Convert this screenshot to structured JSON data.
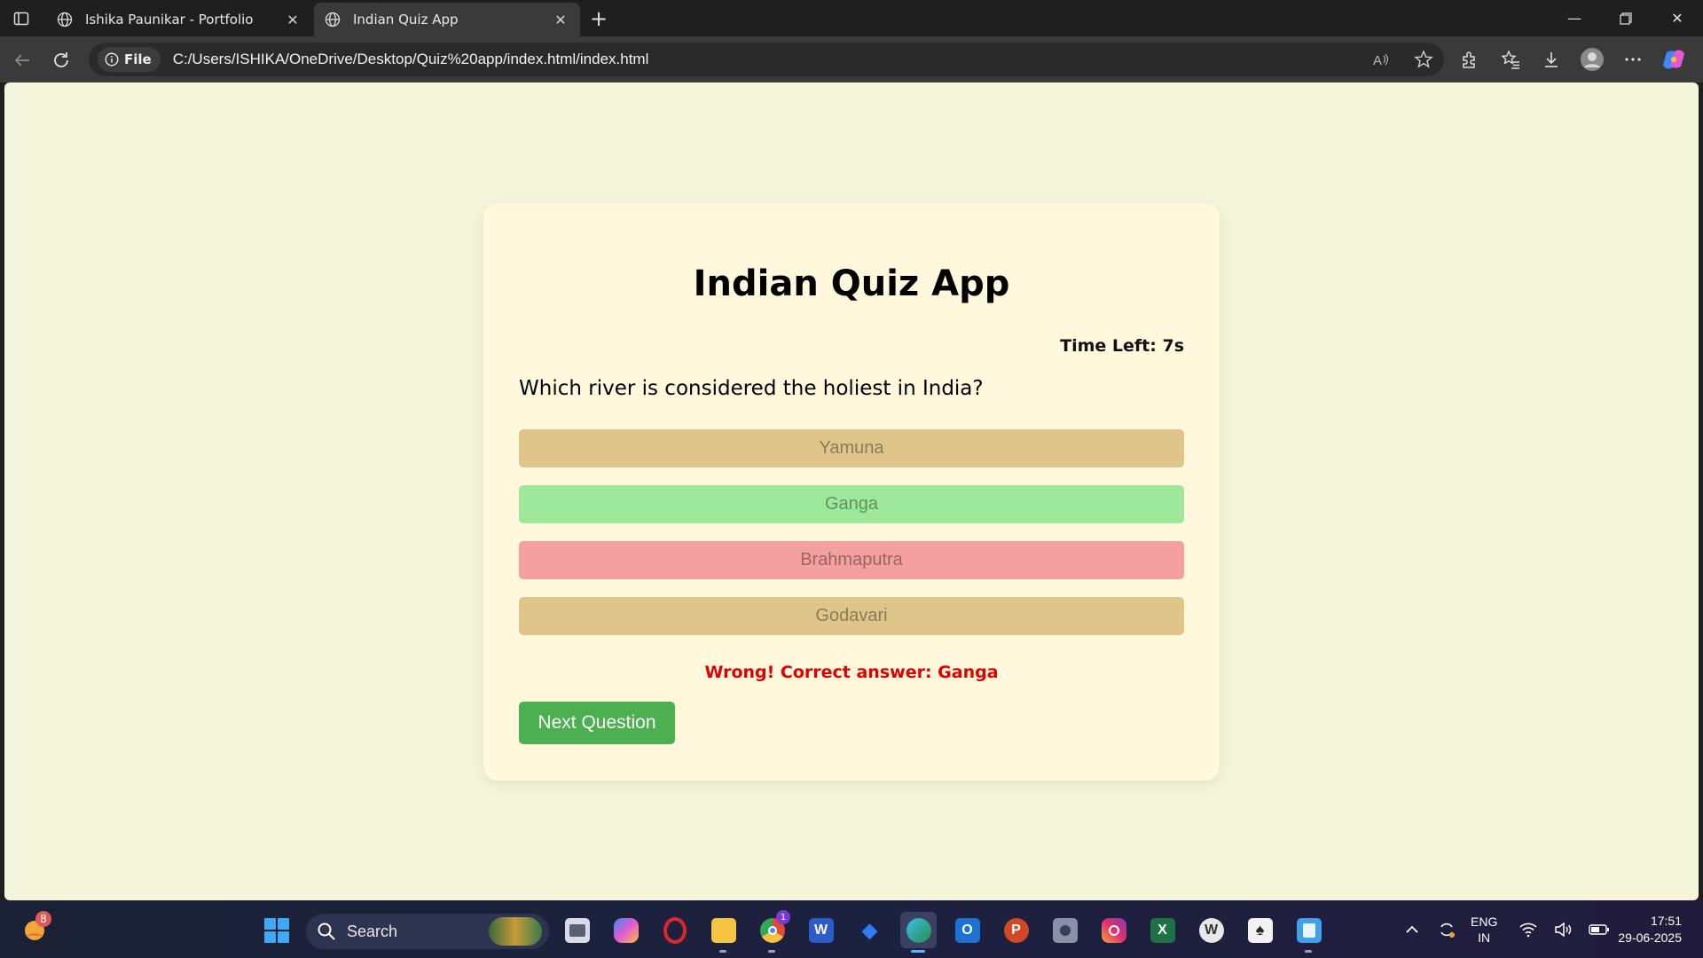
{
  "browser": {
    "tabs": [
      {
        "title": "Ishika Paunikar - Portfolio",
        "active": false
      },
      {
        "title": "Indian Quiz App",
        "active": true
      }
    ],
    "address": {
      "scheme_badge": "File",
      "url": "C:/Users/ISHIKA/OneDrive/Desktop/Quiz%20app/index.html/index.html"
    }
  },
  "quiz": {
    "title": "Indian Quiz App",
    "timer": "Time Left: 7s",
    "question": "Which river is considered the holiest in India?",
    "options": [
      {
        "label": "Yamuna",
        "state": "disabled",
        "color": "#e0c58b"
      },
      {
        "label": "Ganga",
        "state": "correct",
        "color": "#9de89a"
      },
      {
        "label": "Brahmaputra",
        "state": "wrong",
        "color": "#f4a0a0"
      },
      {
        "label": "Godavari",
        "state": "disabled",
        "color": "#e0c58b"
      }
    ],
    "feedback": "Wrong! Correct answer: Ganga",
    "feedback_color": "#e00000",
    "next_button": "Next Question",
    "next_button_color": "#4caf50"
  },
  "taskbar": {
    "weather_badge": "8",
    "search_placeholder": "Search",
    "apps": [
      "file-explorer-icon",
      "copilot-icon",
      "opera-icon",
      "folder-icon",
      "chrome-icon",
      "word-icon",
      "dropbox-icon",
      "edge-icon",
      "outlook-icon",
      "powerpoint-icon",
      "camera-icon",
      "instagram-icon",
      "excel-icon",
      "wordpress-icon",
      "solitaire-icon",
      "notepad-icon"
    ],
    "notification_badge": "1",
    "language": "ENG",
    "region": "IN",
    "time": "17:51",
    "date": "29-06-2025"
  }
}
